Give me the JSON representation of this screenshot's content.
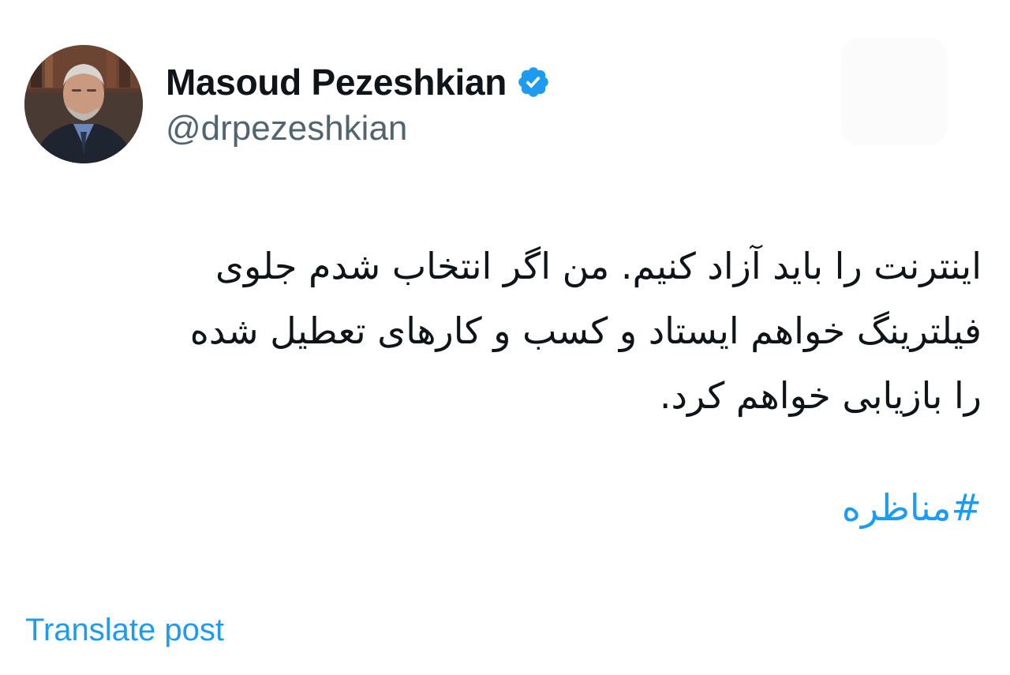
{
  "author": {
    "display_name": "Masoud Pezeshkian",
    "handle": "@drpezeshkian",
    "verified": true,
    "verified_icon": "verified-badge-icon"
  },
  "post": {
    "text_lines": [
      "اینترنت را باید آزاد کنیم. من اگر انتخاب شدم جلوی",
      "فیلترینگ خواهم ایستاد و کسب و کارهای تعطیل شده",
      "را بازیابی خواهم کرد."
    ],
    "hashtag": "#مناظره"
  },
  "actions": {
    "translate_label": "Translate post"
  },
  "colors": {
    "text": "#0f1419",
    "secondary": "#536471",
    "accent": "#1d9bf0"
  }
}
